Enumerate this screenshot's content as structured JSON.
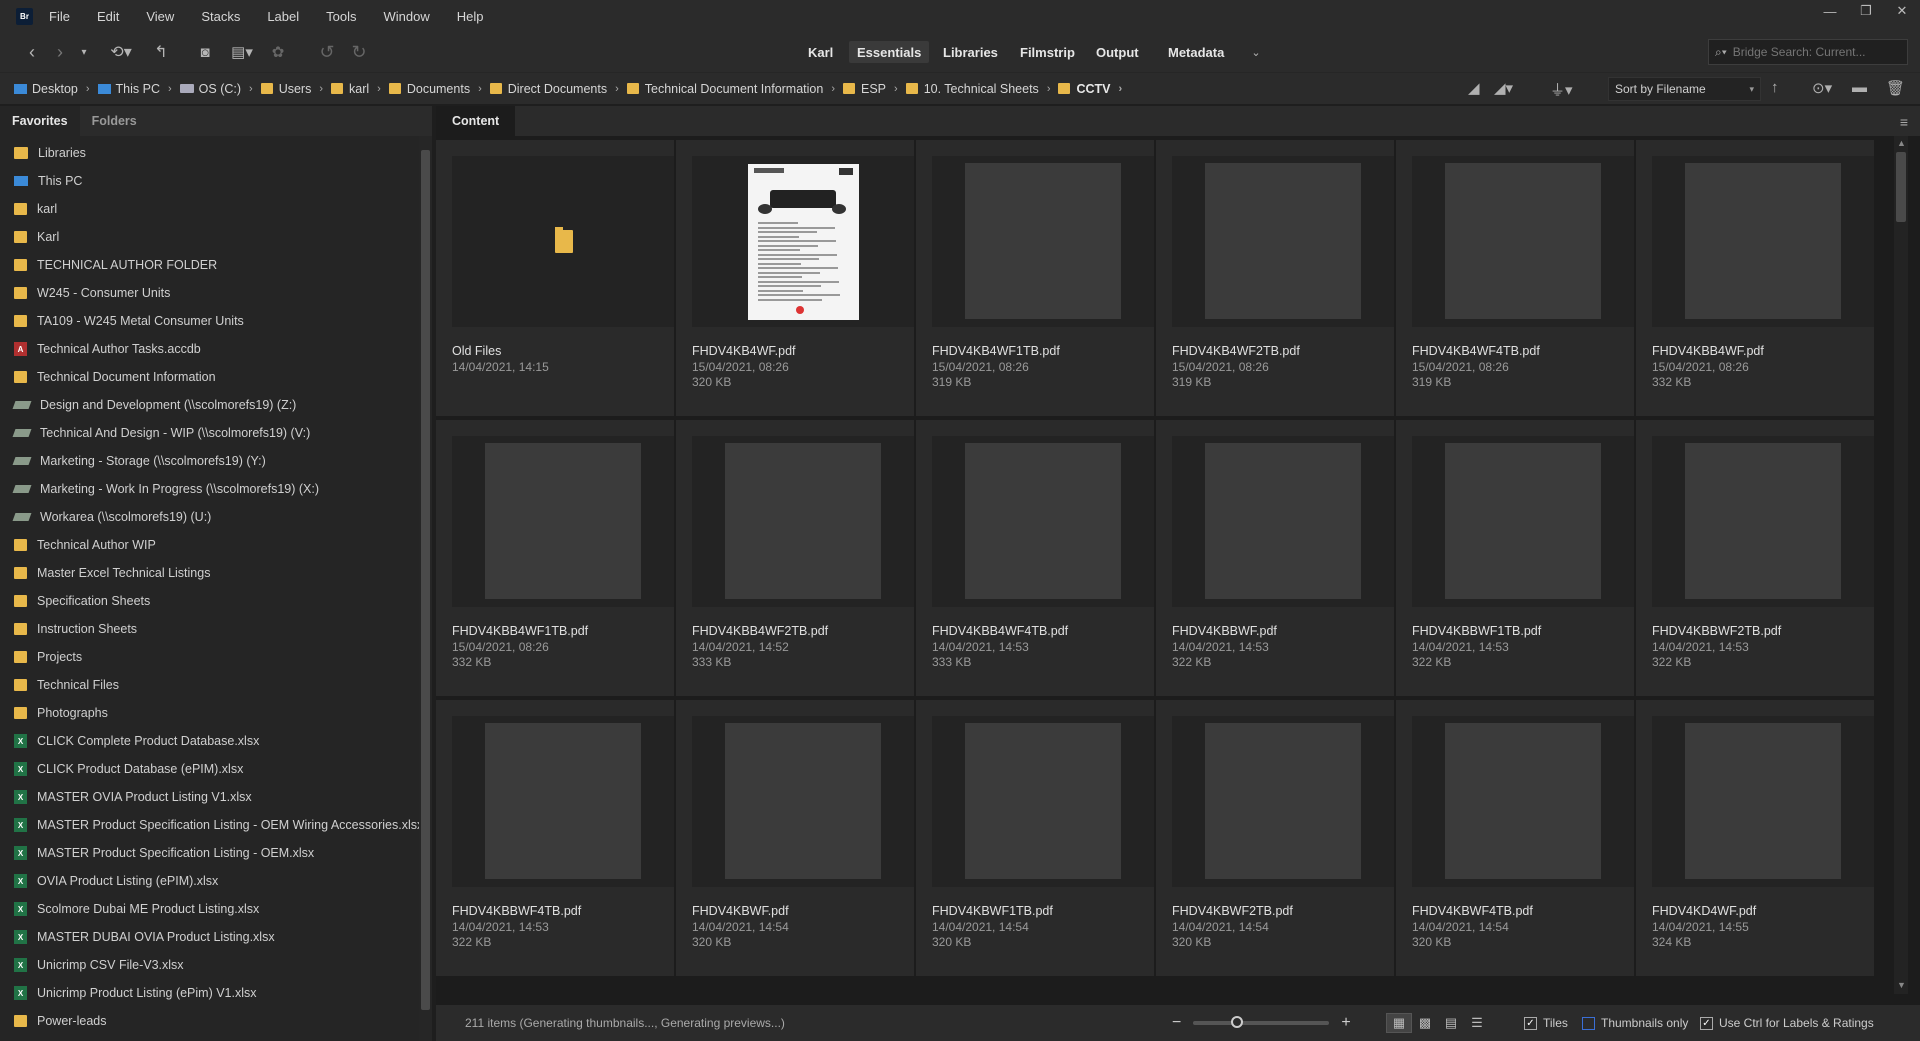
{
  "app": {
    "logo": "Br"
  },
  "menu": [
    "File",
    "Edit",
    "View",
    "Stacks",
    "Label",
    "Tools",
    "Window",
    "Help"
  ],
  "window_controls": {
    "minimize": "—",
    "restore": "❐",
    "close": "✕"
  },
  "toolbar": {
    "workspaces": [
      "Karl",
      "Essentials",
      "Libraries",
      "Filmstrip",
      "Output",
      "Metadata"
    ],
    "active_workspace": "Essentials",
    "search_placeholder": "Bridge Search: Current..."
  },
  "breadcrumb": [
    {
      "label": "Desktop",
      "icon": "desktop-icon"
    },
    {
      "label": "This PC",
      "icon": "computer-icon"
    },
    {
      "label": "OS (C:)",
      "icon": "drive-icon"
    },
    {
      "label": "Users",
      "icon": "folder-icon"
    },
    {
      "label": "karl",
      "icon": "folder-icon"
    },
    {
      "label": "Documents",
      "icon": "documents-icon"
    },
    {
      "label": "Direct Documents",
      "icon": "folder-icon"
    },
    {
      "label": "Technical Document Information",
      "icon": "folder-icon"
    },
    {
      "label": "ESP",
      "icon": "folder-icon"
    },
    {
      "label": "10. Technical Sheets",
      "icon": "folder-icon"
    },
    {
      "label": "CCTV",
      "icon": "folder-icon"
    }
  ],
  "sort": {
    "label": "Sort by Filename"
  },
  "left_panel": {
    "tabs": [
      "Favorites",
      "Folders"
    ],
    "active_tab": "Favorites",
    "items": [
      {
        "label": "Libraries",
        "icon": "lib"
      },
      {
        "label": "This PC",
        "icon": "pc"
      },
      {
        "label": "karl",
        "icon": "folder"
      },
      {
        "label": "Karl",
        "icon": "folder"
      },
      {
        "label": "TECHNICAL AUTHOR FOLDER",
        "icon": "folder"
      },
      {
        "label": "W245 - Consumer Units",
        "icon": "folder"
      },
      {
        "label": "TA109 - W245 Metal Consumer Units",
        "icon": "folder"
      },
      {
        "label": "Technical Author Tasks.accdb",
        "icon": "access"
      },
      {
        "label": "Technical Document Information",
        "icon": "folder"
      },
      {
        "label": "Design and Development (\\\\scolmorefs19) (Z:)",
        "icon": "drive"
      },
      {
        "label": "Technical And Design - WIP (\\\\scolmorefs19) (V:)",
        "icon": "drive"
      },
      {
        "label": "Marketing - Storage (\\\\scolmorefs19) (Y:)",
        "icon": "drive"
      },
      {
        "label": "Marketing - Work In Progress (\\\\scolmorefs19) (X:)",
        "icon": "drive"
      },
      {
        "label": "Workarea (\\\\scolmorefs19) (U:)",
        "icon": "drive"
      },
      {
        "label": "Technical Author WIP",
        "icon": "folder"
      },
      {
        "label": "Master Excel Technical Listings",
        "icon": "folder"
      },
      {
        "label": "Specification Sheets",
        "icon": "folder"
      },
      {
        "label": "Instruction Sheets",
        "icon": "folder"
      },
      {
        "label": "Projects",
        "icon": "folder"
      },
      {
        "label": "Technical Files",
        "icon": "folder"
      },
      {
        "label": "Photographs",
        "icon": "folder"
      },
      {
        "label": "CLICK Complete Product Database.xlsx",
        "icon": "excel"
      },
      {
        "label": "CLICK Product Database (ePIM).xlsx",
        "icon": "excel"
      },
      {
        "label": "MASTER OVIA Product Listing V1.xlsx",
        "icon": "excel"
      },
      {
        "label": "MASTER Product Specification Listing - OEM Wiring Accessories.xlsx",
        "icon": "excel"
      },
      {
        "label": "MASTER Product Specification Listing - OEM.xlsx",
        "icon": "excel"
      },
      {
        "label": "OVIA Product Listing (ePIM).xlsx",
        "icon": "excel"
      },
      {
        "label": "Scolmore Dubai ME Product Listing.xlsx",
        "icon": "excel"
      },
      {
        "label": "MASTER DUBAI OVIA Product Listing.xlsx",
        "icon": "excel"
      },
      {
        "label": "Unicrimp CSV File-V3.xlsx",
        "icon": "excel"
      },
      {
        "label": "Unicrimp Product Listing (ePim) V1.xlsx",
        "icon": "excel"
      },
      {
        "label": "Power-leads",
        "icon": "folder"
      }
    ]
  },
  "content": {
    "tab": "Content",
    "files": [
      {
        "name": "Old Files",
        "date": "14/04/2021, 14:15",
        "size": "",
        "kind": "folder"
      },
      {
        "name": "FHDV4KB4WF.pdf",
        "date": "15/04/2021, 08:26",
        "size": "320 KB",
        "kind": "doc"
      },
      {
        "name": "FHDV4KB4WF1TB.pdf",
        "date": "15/04/2021, 08:26",
        "size": "319 KB",
        "kind": "pending"
      },
      {
        "name": "FHDV4KB4WF2TB.pdf",
        "date": "15/04/2021, 08:26",
        "size": "319 KB",
        "kind": "pending"
      },
      {
        "name": "FHDV4KB4WF4TB.pdf",
        "date": "15/04/2021, 08:26",
        "size": "319 KB",
        "kind": "pending"
      },
      {
        "name": "FHDV4KBB4WF.pdf",
        "date": "15/04/2021, 08:26",
        "size": "332 KB",
        "kind": "pending"
      },
      {
        "name": "FHDV4KBB4WF1TB.pdf",
        "date": "15/04/2021, 08:26",
        "size": "332 KB",
        "kind": "pending"
      },
      {
        "name": "FHDV4KBB4WF2TB.pdf",
        "date": "14/04/2021, 14:52",
        "size": "333 KB",
        "kind": "pending"
      },
      {
        "name": "FHDV4KBB4WF4TB.pdf",
        "date": "14/04/2021, 14:53",
        "size": "333 KB",
        "kind": "pending"
      },
      {
        "name": "FHDV4KBBWF.pdf",
        "date": "14/04/2021, 14:53",
        "size": "322 KB",
        "kind": "pending"
      },
      {
        "name": "FHDV4KBBWF1TB.pdf",
        "date": "14/04/2021, 14:53",
        "size": "322 KB",
        "kind": "pending"
      },
      {
        "name": "FHDV4KBBWF2TB.pdf",
        "date": "14/04/2021, 14:53",
        "size": "322 KB",
        "kind": "pending"
      },
      {
        "name": "FHDV4KBBWF4TB.pdf",
        "date": "14/04/2021, 14:53",
        "size": "322 KB",
        "kind": "pending"
      },
      {
        "name": "FHDV4KBWF.pdf",
        "date": "14/04/2021, 14:54",
        "size": "320 KB",
        "kind": "pending"
      },
      {
        "name": "FHDV4KBWF1TB.pdf",
        "date": "14/04/2021, 14:54",
        "size": "320 KB",
        "kind": "pending"
      },
      {
        "name": "FHDV4KBWF2TB.pdf",
        "date": "14/04/2021, 14:54",
        "size": "320 KB",
        "kind": "pending"
      },
      {
        "name": "FHDV4KBWF4TB.pdf",
        "date": "14/04/2021, 14:54",
        "size": "320 KB",
        "kind": "pending"
      },
      {
        "name": "FHDV4KD4WF.pdf",
        "date": "14/04/2021, 14:55",
        "size": "324 KB",
        "kind": "pending"
      }
    ]
  },
  "status": {
    "text": "211 items (Generating thumbnails..., Generating previews...)",
    "zoom_level": 0.3,
    "options": [
      {
        "label": "Tiles",
        "checked": true
      },
      {
        "label": "Thumbnails only",
        "checked": false
      },
      {
        "label": "Use Ctrl for Labels & Ratings",
        "checked": true
      }
    ]
  }
}
